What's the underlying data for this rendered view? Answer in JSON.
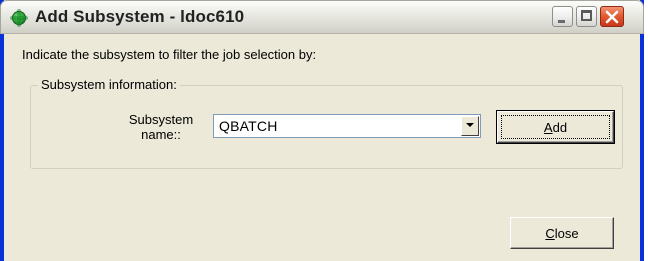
{
  "window": {
    "title": "Add Subsystem - ldoc610",
    "icon": "green-app-icon",
    "controls": {
      "minimize": "minimize-icon",
      "maximize": "maximize-icon",
      "close": "close-icon"
    }
  },
  "content": {
    "instruction": "Indicate the subsystem to filter the job selection by:",
    "group": {
      "legend": "Subsystem information:",
      "field_label": "Subsystem name::",
      "combo_value": "QBATCH",
      "add_button": {
        "mnemonic": "A",
        "rest": "dd"
      }
    },
    "close_button": {
      "mnemonic": "C",
      "rest": "lose"
    }
  },
  "colors": {
    "window_border": "#0831d9",
    "dialog_bg": "#ece9d8",
    "close_button_red": "#e35d33"
  }
}
